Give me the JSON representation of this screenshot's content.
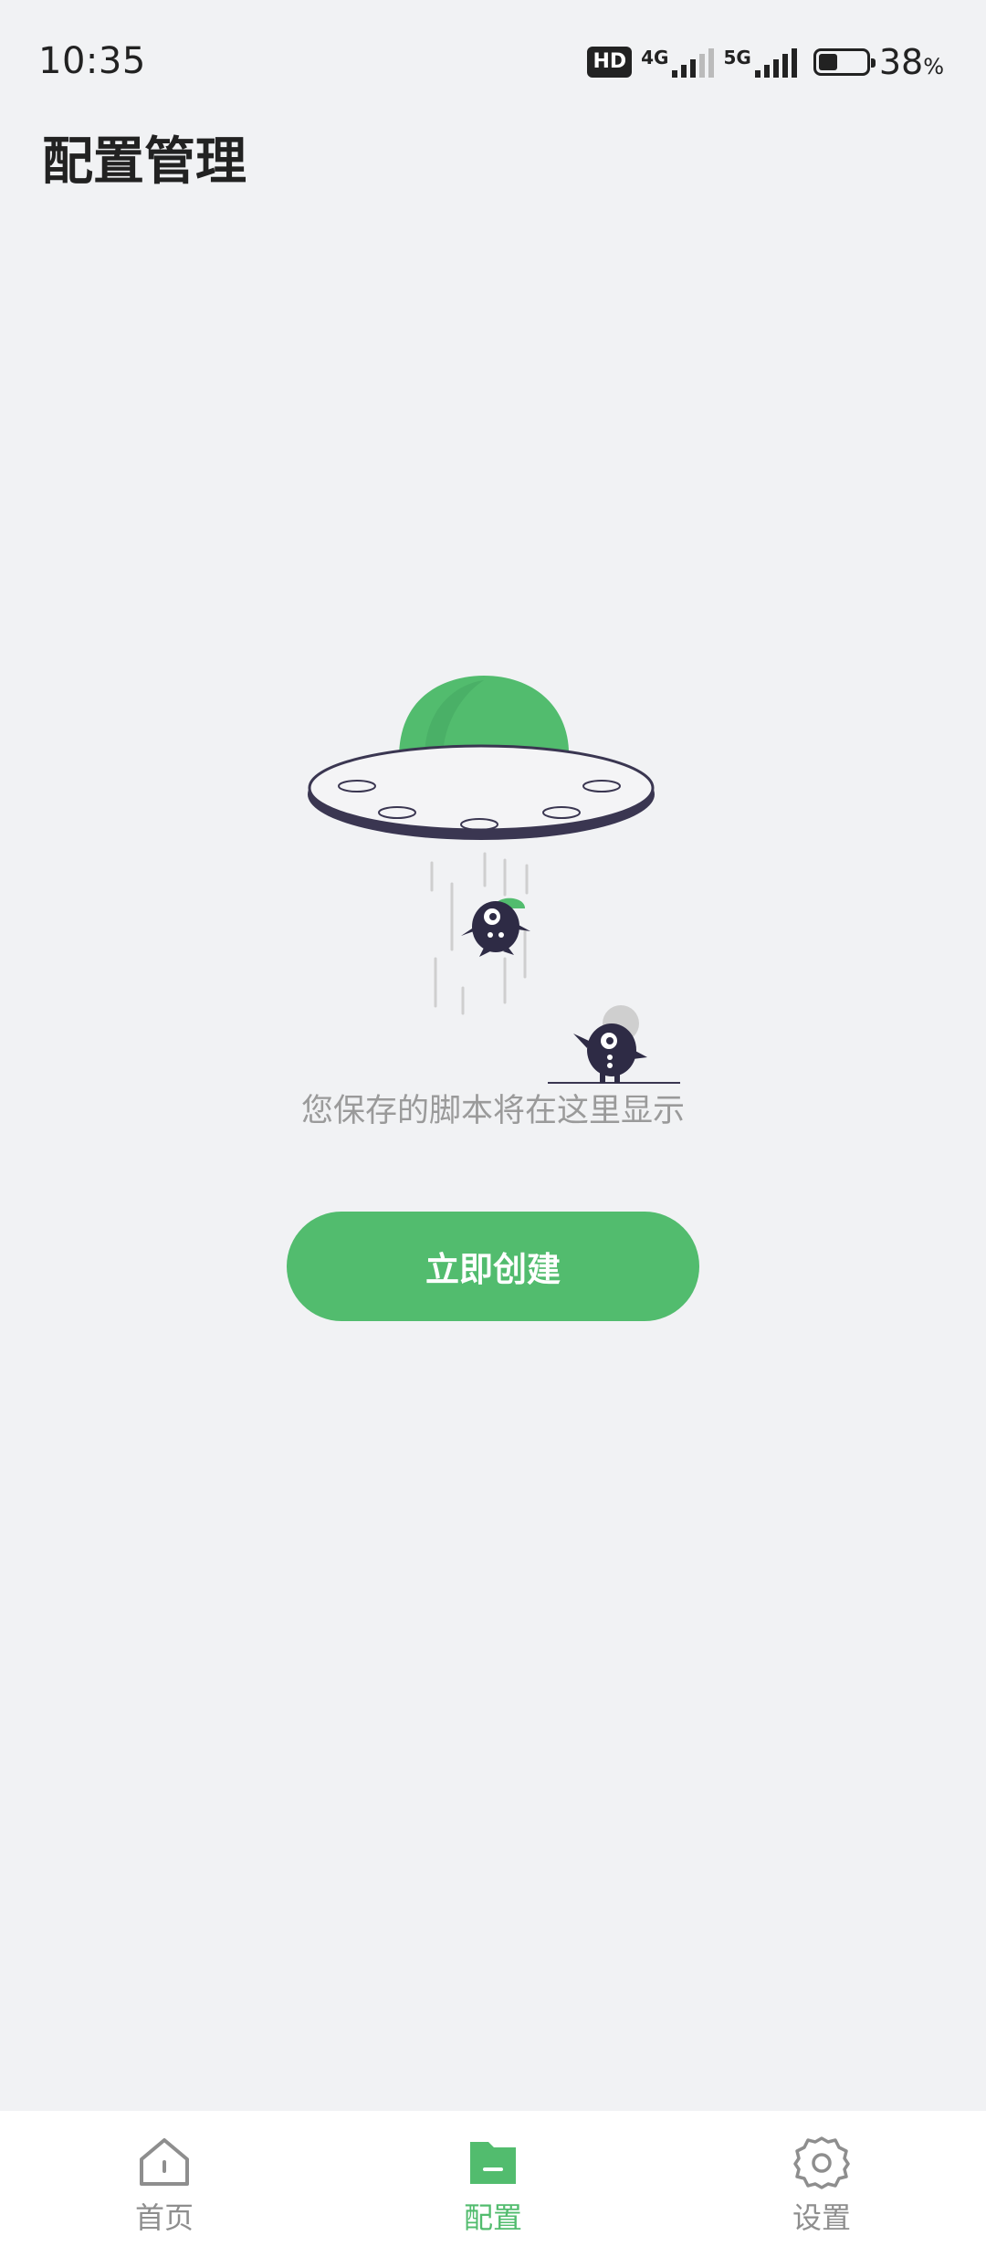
{
  "status_bar": {
    "time": "10:35",
    "hd_badge": "HD",
    "network_1": "4G",
    "network_2": "5G",
    "battery_percent": "38",
    "battery_unit": "%"
  },
  "header": {
    "title": "配置管理"
  },
  "empty_state": {
    "illustration": "ufo-abduction-illustration",
    "message": "您保存的脚本将在这里显示",
    "create_button_label": "立即创建"
  },
  "bottom_nav": {
    "items": [
      {
        "label": "首页",
        "icon": "home-icon",
        "active": false
      },
      {
        "label": "配置",
        "icon": "folder-icon",
        "active": true
      },
      {
        "label": "设置",
        "icon": "gear-icon",
        "active": false
      }
    ]
  },
  "colors": {
    "accent": "#52bc6e",
    "background": "#f1f2f4",
    "nav_inactive": "#8e8e8e",
    "dark_figure": "#2e2b45"
  }
}
